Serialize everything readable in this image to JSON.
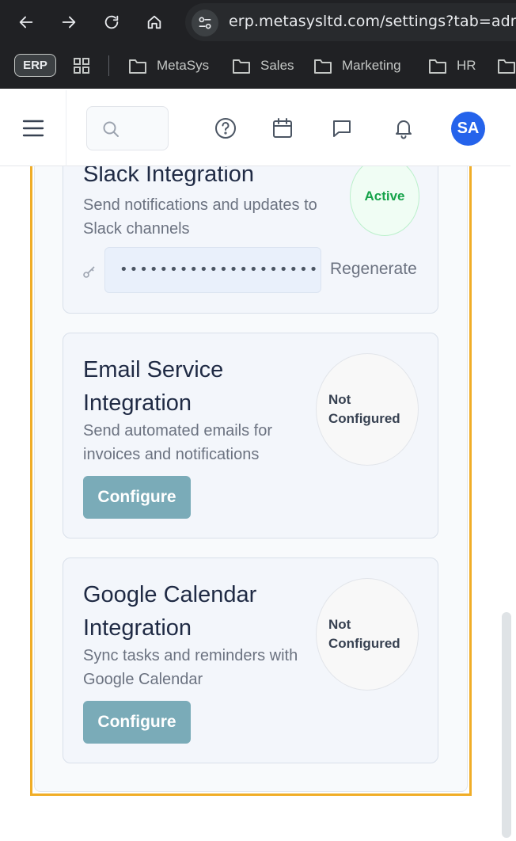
{
  "browser": {
    "url": "erp.metasysltd.com/settings?tab=admin",
    "bookmarks": {
      "erp_chip": "ERP",
      "items": [
        "MetaSys",
        "Sales",
        "Marketing",
        "HR",
        ""
      ]
    }
  },
  "header": {
    "search_placeholder": "",
    "avatar_initials": "SA",
    "avatar_color": "#2563eb"
  },
  "integrations": [
    {
      "title": "Slack Integration",
      "description": "Send notifications and updates to Slack channels",
      "status": "Active",
      "api_key_masked": "•••••••••••••••••••••••",
      "regenerate_label": "Regenerate"
    },
    {
      "title": "Email Service Integration",
      "description": "Send automated emails for invoices and notifications",
      "status": "Not Configured",
      "action_label": "Configure"
    },
    {
      "title": "Google Calendar Integration",
      "description": "Sync tasks and reminders with Google Calendar",
      "status": "Not Configured",
      "action_label": "Configure"
    }
  ],
  "colors": {
    "active": "#16a34a",
    "configure_button": "#7aabb8",
    "highlight_frame": "#f0ad27"
  }
}
